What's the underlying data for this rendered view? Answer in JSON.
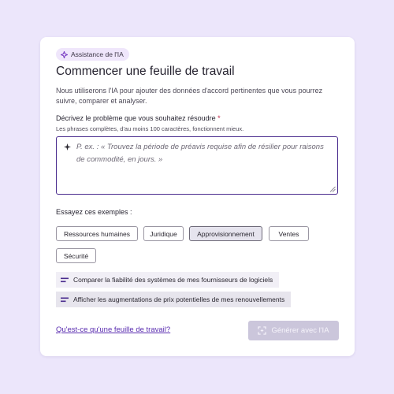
{
  "badge": {
    "label": "Assistance de l'IA",
    "icon": "ai-spark-icon"
  },
  "title": "Commencer une feuille de travail",
  "subtitle": "Nous utiliserons l'IA pour ajouter des données d'accord pertinentes que vous pourrez suivre, comparer et analyser.",
  "field": {
    "label": "Décrivez le problème que vous souhaitez résoudre",
    "required_mark": "*",
    "hint": "Les phrases complètes, d'au moins 100 caractères, fonctionnent mieux.",
    "value": "",
    "placeholder": "P. ex. : « Trouvez la période de préavis requise afin de résilier pour raisons de commodité, en jours. »"
  },
  "examples": {
    "label": "Essayez ces exemples :",
    "chips": [
      {
        "label": "Ressources humaines",
        "selected": false
      },
      {
        "label": "Juridique",
        "selected": false
      },
      {
        "label": "Approvisionnement",
        "selected": true
      },
      {
        "label": "Ventes",
        "selected": false
      },
      {
        "label": "Sécurité",
        "selected": false
      }
    ]
  },
  "suggestions": [
    {
      "text": "Comparer la fiabilité des systèmes de mes fournisseurs de logiciels"
    },
    {
      "text": "Afficher les augmentations de prix potentielles de mes renouvellements"
    }
  ],
  "footer": {
    "link": "Qu'est-ce qu'une feuille de travail?",
    "generate_button": "Générer avec l'IA"
  },
  "colors": {
    "background": "#ece6fb",
    "accent": "#4a2c8e",
    "link": "#5a2db0",
    "badge_bg": "#efe6fb",
    "disabled_button": "#cbc6db"
  }
}
